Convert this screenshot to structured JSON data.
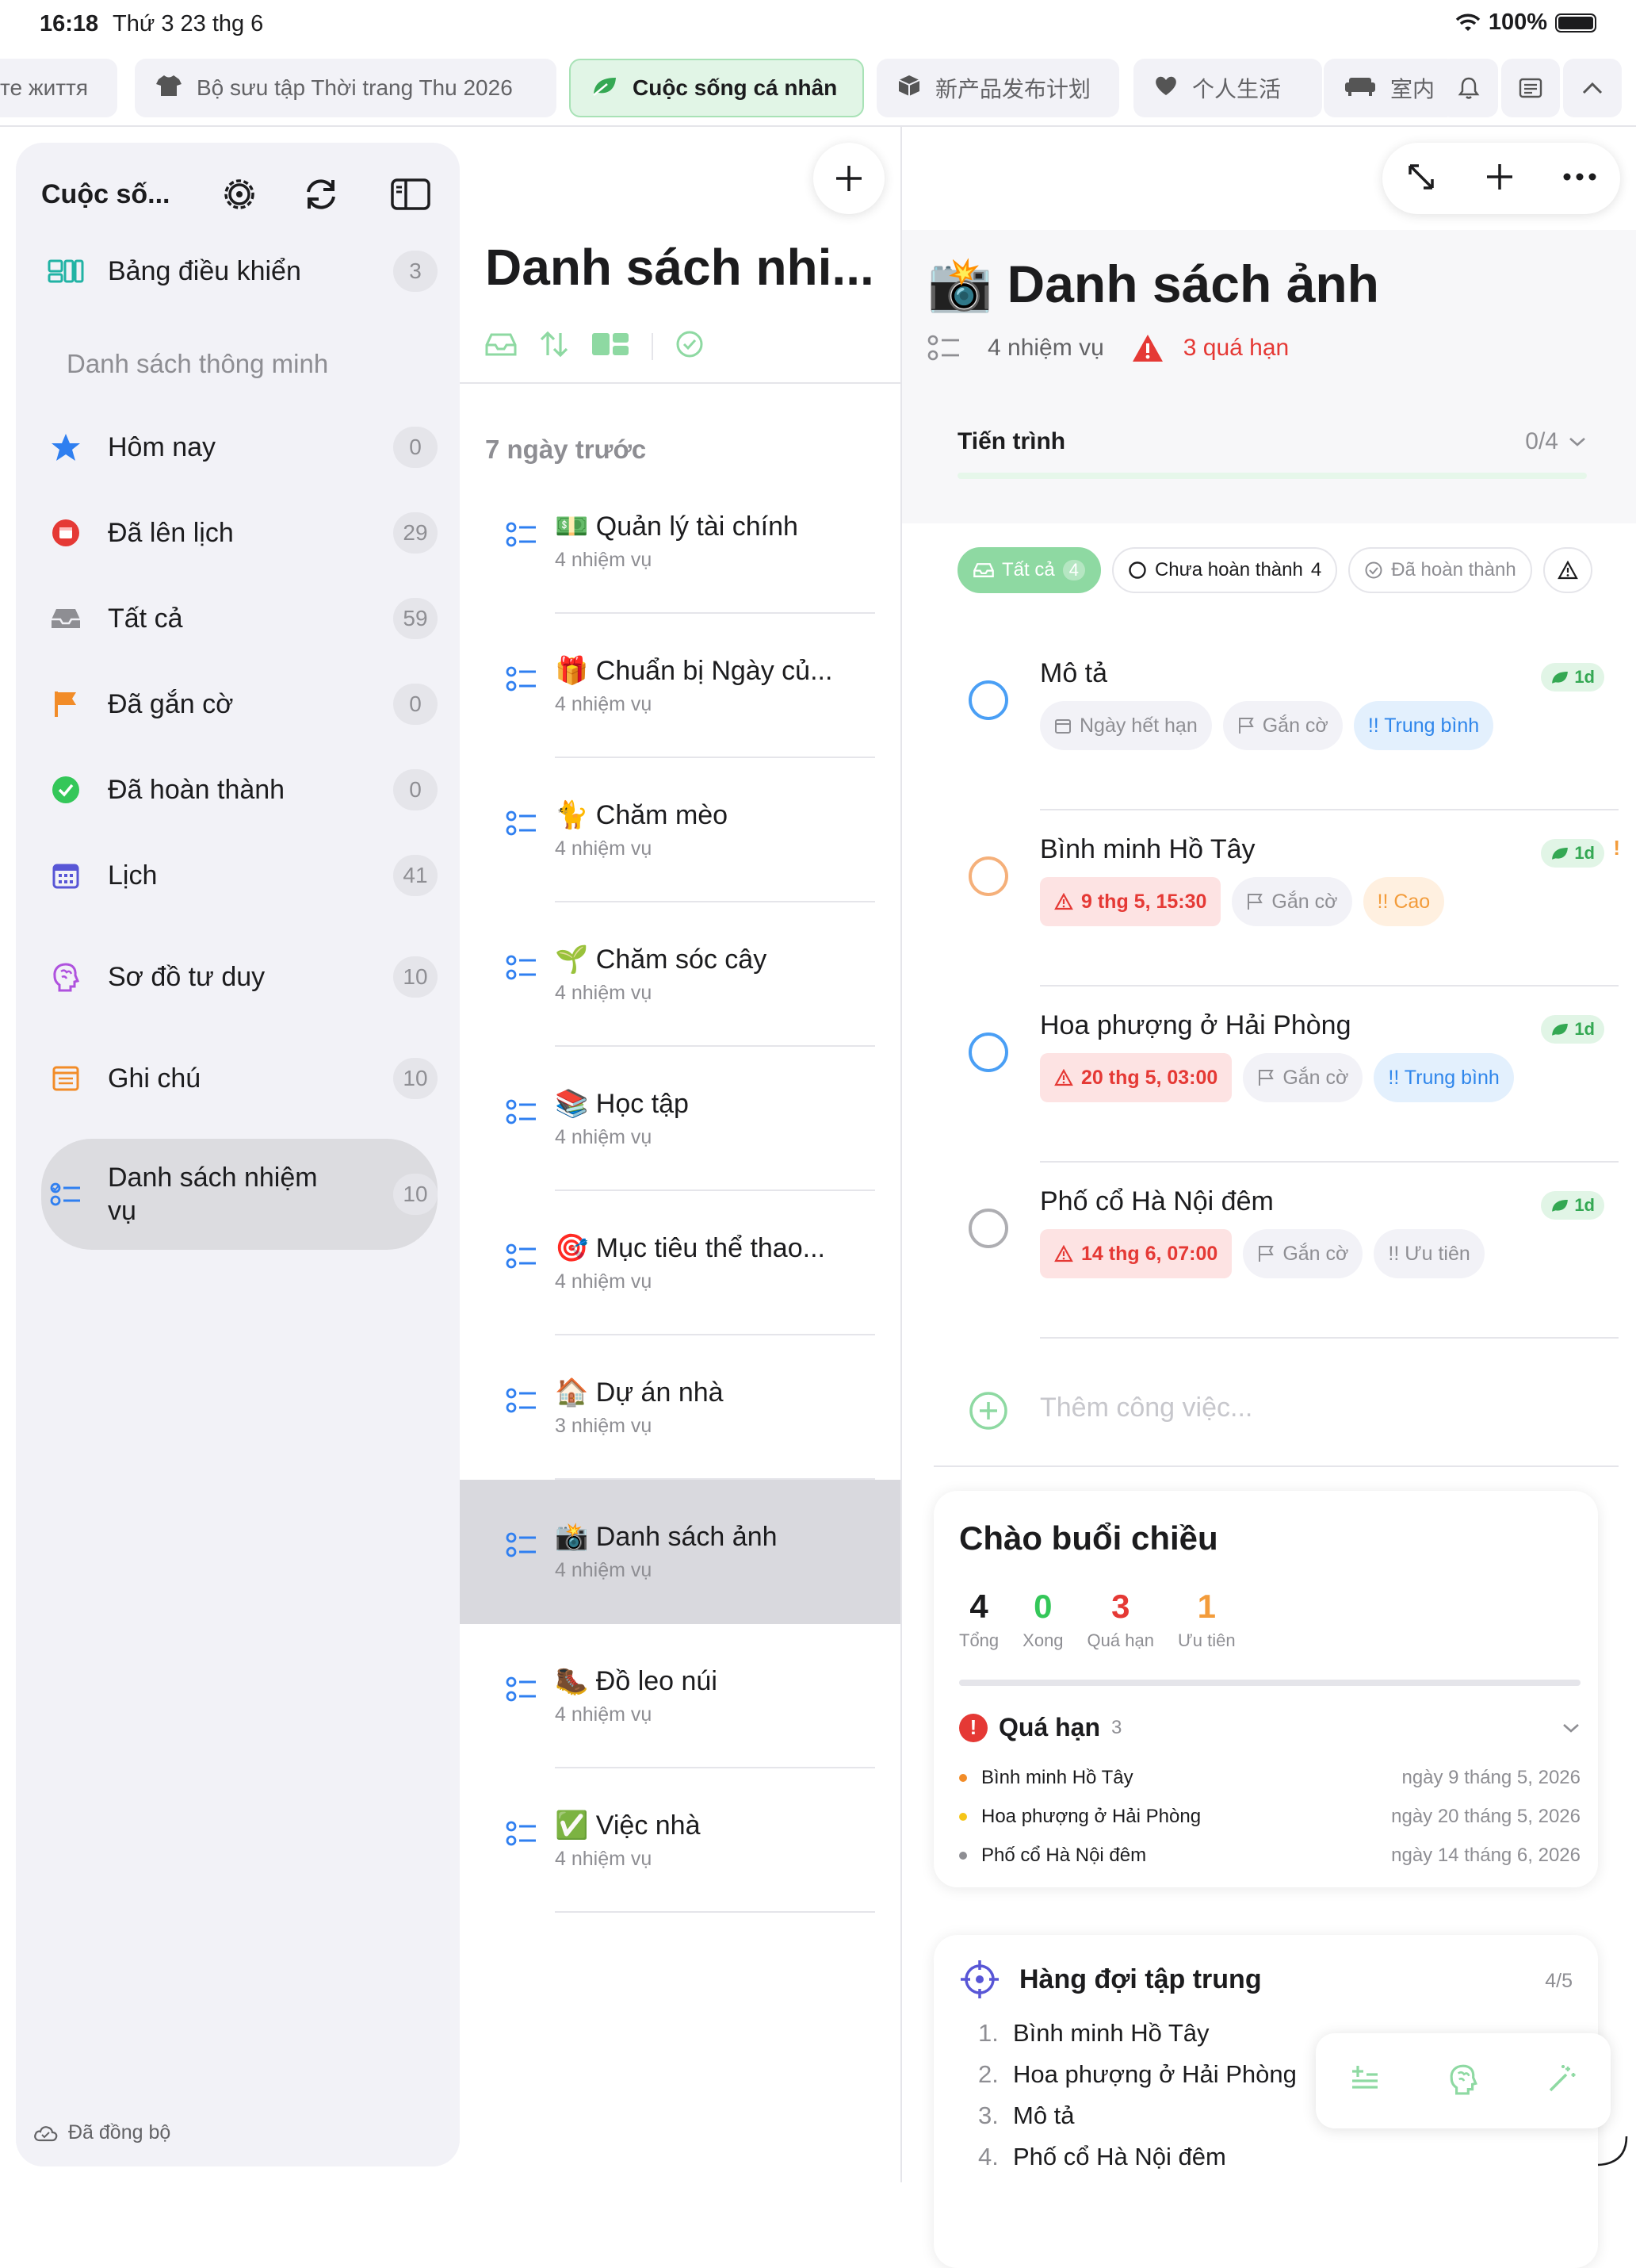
{
  "status": {
    "time": "16:18",
    "date": "Thứ 3 23 thg 6",
    "battery": "100%"
  },
  "tabs": [
    {
      "label": "те життя",
      "icon": "none"
    },
    {
      "label": "Bộ sưu tập Thời trang Thu 2026",
      "icon": "tshirt-icon"
    },
    {
      "label": "Cuộc sống cá nhân",
      "icon": "leaf-icon",
      "active": true
    },
    {
      "label": "新产品发布计划",
      "icon": "cube-icon"
    },
    {
      "label": "个人生活",
      "icon": "heart-icon"
    },
    {
      "label": "室内",
      "icon": "sofa-icon"
    }
  ],
  "sidebar": {
    "title": "Cuộc số...",
    "dashboard": {
      "label": "Bảng điều khiển",
      "count": "3"
    },
    "smart_title": "Danh sách thông minh",
    "items": [
      {
        "label": "Hôm nay",
        "count": "0"
      },
      {
        "label": "Đã lên lịch",
        "count": "29"
      },
      {
        "label": "Tất cả",
        "count": "59"
      },
      {
        "label": "Đã gắn cờ",
        "count": "0"
      },
      {
        "label": "Đã hoàn thành",
        "count": "0"
      },
      {
        "label": "Lịch",
        "count": "41"
      },
      {
        "label": "Sơ đồ tư duy",
        "count": "10"
      },
      {
        "label": "Ghi chú",
        "count": "10"
      },
      {
        "label": "Danh sách nhiệm vụ",
        "count": "10"
      }
    ],
    "synced": "Đã đồng bộ"
  },
  "middle": {
    "title": "Danh sách nhi...",
    "group": "7 ngày trước",
    "lists": [
      {
        "emoji": "💵",
        "name": "Quản lý tài chính",
        "sub": "4 nhiệm vụ"
      },
      {
        "emoji": "🎁",
        "name": "Chuẩn bị Ngày củ...",
        "sub": "4 nhiệm vụ"
      },
      {
        "emoji": "🐈",
        "name": "Chăm mèo",
        "sub": "4 nhiệm vụ"
      },
      {
        "emoji": "🌱",
        "name": "Chăm sóc cây",
        "sub": "4 nhiệm vụ"
      },
      {
        "emoji": "📚",
        "name": "Học tập",
        "sub": "4 nhiệm vụ"
      },
      {
        "emoji": "🎯",
        "name": "Mục tiêu thể thao...",
        "sub": "4 nhiệm vụ"
      },
      {
        "emoji": "🏠",
        "name": "Dự án nhà",
        "sub": "3 nhiệm vụ"
      },
      {
        "emoji": "📸",
        "name": "Danh sách ảnh",
        "sub": "4 nhiệm vụ"
      },
      {
        "emoji": "🥾",
        "name": "Đồ leo núi",
        "sub": "4 nhiệm vụ"
      },
      {
        "emoji": "✅",
        "name": "Việc nhà",
        "sub": "4 nhiệm vụ"
      }
    ]
  },
  "detail": {
    "emoji": "📸",
    "title": "Danh sách ảnh",
    "task_count": "4 nhiệm vụ",
    "overdue": "3 quá hạn",
    "progress_label": "Tiến trình",
    "progress_value": "0/4",
    "progress_fraction": 0,
    "filters": {
      "all": "Tất cả",
      "all_count": "4",
      "open": "Chưa hoàn thành",
      "open_count": "4",
      "done": "Đã hoàn thành"
    },
    "tasks": [
      {
        "name": "Mô tả",
        "age": "1d",
        "due": "Ngày hết hạn",
        "flag": "Gắn cờ",
        "priority": "!! Trung bình"
      },
      {
        "name": "Bình minh Hồ Tây",
        "age": "1d",
        "excl": "!",
        "due": "9 thg 5, 15:30",
        "flag": "Gắn cờ",
        "priority": "!! Cao"
      },
      {
        "name": "Hoa phượng ở Hải Phòng",
        "age": "1d",
        "due": "20 thg 5, 03:00",
        "flag": "Gắn cờ",
        "priority": "!! Trung bình"
      },
      {
        "name": "Phố cổ Hà Nội đêm",
        "age": "1d",
        "due": "14 thg 6, 07:00",
        "flag": "Gắn cờ",
        "priority": "!! Ưu tiên"
      }
    ],
    "add_placeholder": "Thêm công việc...",
    "summary": {
      "greeting": "Chào buổi chiều",
      "stats": [
        {
          "n": "4",
          "label": "Tổng"
        },
        {
          "n": "0",
          "label": "Xong"
        },
        {
          "n": "3",
          "label": "Quá hạn"
        },
        {
          "n": "1",
          "label": "Ưu tiên"
        }
      ],
      "overdue_title": "Quá hạn",
      "overdue_count": "3",
      "overdue_items": [
        {
          "name": "Bình minh Hồ Tây",
          "date": "ngày 9 tháng 5, 2026"
        },
        {
          "name": "Hoa phượng ở Hải Phòng",
          "date": "ngày 20 tháng 5, 2026"
        },
        {
          "name": "Phố cổ Hà Nội đêm",
          "date": "ngày 14 tháng 6, 2026"
        }
      ]
    },
    "focus": {
      "title": "Hàng đợi tập trung",
      "count": "4/5",
      "items": [
        {
          "n": "1.",
          "name": "Bình minh Hồ Tây"
        },
        {
          "n": "2.",
          "name": "Hoa phượng ở Hải Phòng"
        },
        {
          "n": "3.",
          "name": "Mô tả"
        },
        {
          "n": "4.",
          "name": "Phố cổ Hà Nội đêm"
        }
      ]
    }
  },
  "colors": {
    "accent": "#34c759",
    "red": "#e53935",
    "blue": "#2f86eb",
    "orange": "#f39c3b"
  }
}
